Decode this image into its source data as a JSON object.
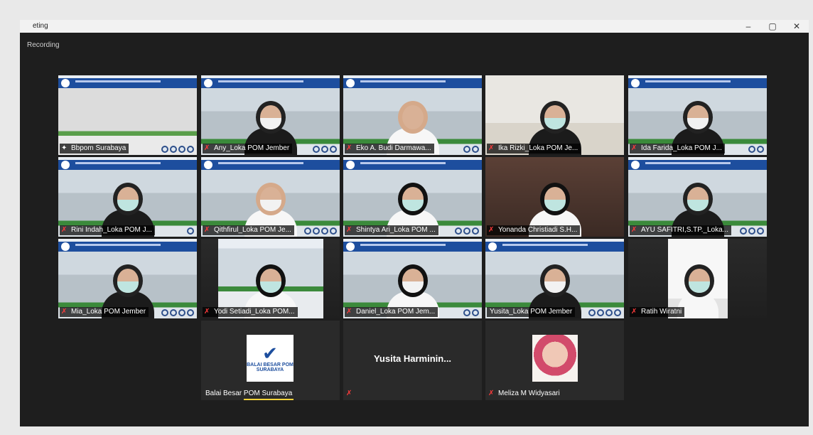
{
  "window": {
    "title_fragment": "eting",
    "recording_label": "Recording",
    "controls": {
      "minimize": "–",
      "maximize": "▢",
      "close": "✕"
    }
  },
  "participants": [
    {
      "name": "Bbpom Surabaya",
      "muted": false,
      "active": true,
      "kind": "slide"
    },
    {
      "name": "Any_Loka POM Jember",
      "muted": true,
      "kind": "person-hijab"
    },
    {
      "name": "Eko  A. Budi  Darmawa...",
      "muted": true,
      "kind": "person"
    },
    {
      "name": "Ika Rizki_Loka POM Je...",
      "muted": true,
      "kind": "person-hijab-room"
    },
    {
      "name": "Ida Farida_Loka POM J...",
      "muted": true,
      "kind": "person-hijab"
    },
    {
      "name": "Rini Indah_Loka POM J...",
      "muted": true,
      "kind": "person-hijab"
    },
    {
      "name": "Qithfirul_Loka POM Je...",
      "muted": true,
      "kind": "person"
    },
    {
      "name": "Shintya Ari_Loka POM ...",
      "muted": true,
      "kind": "person"
    },
    {
      "name": "Yonanda Christiadi S.H...",
      "muted": true,
      "kind": "person-room"
    },
    {
      "name": "AYU SAFITRI,S.TP._Loka...",
      "muted": true,
      "kind": "person-hijab"
    },
    {
      "name": "Mia_Loka POM Jember",
      "muted": true,
      "kind": "person-hijab"
    },
    {
      "name": "Yodi Setiadi_Loka POM...",
      "muted": true,
      "kind": "person-dark"
    },
    {
      "name": "Daniel_Loka POM Jem...",
      "muted": true,
      "kind": "person"
    },
    {
      "name": "Yusita_Loka POM Jember",
      "muted": false,
      "kind": "person-hijab"
    },
    {
      "name": "Ratih Wiratni",
      "muted": true,
      "kind": "person-wall"
    },
    {
      "name": "Balai Besar POM Surabaya",
      "muted": false,
      "kind": "logo",
      "logo_lines": [
        "BALAI BESAR POM",
        "SURABAYA"
      ],
      "speaking": true
    },
    {
      "name": "",
      "display_name": "Yusita  Harminin...",
      "muted": true,
      "kind": "text"
    },
    {
      "name": "Meliza M Widyasari",
      "muted": true,
      "kind": "photo"
    }
  ]
}
